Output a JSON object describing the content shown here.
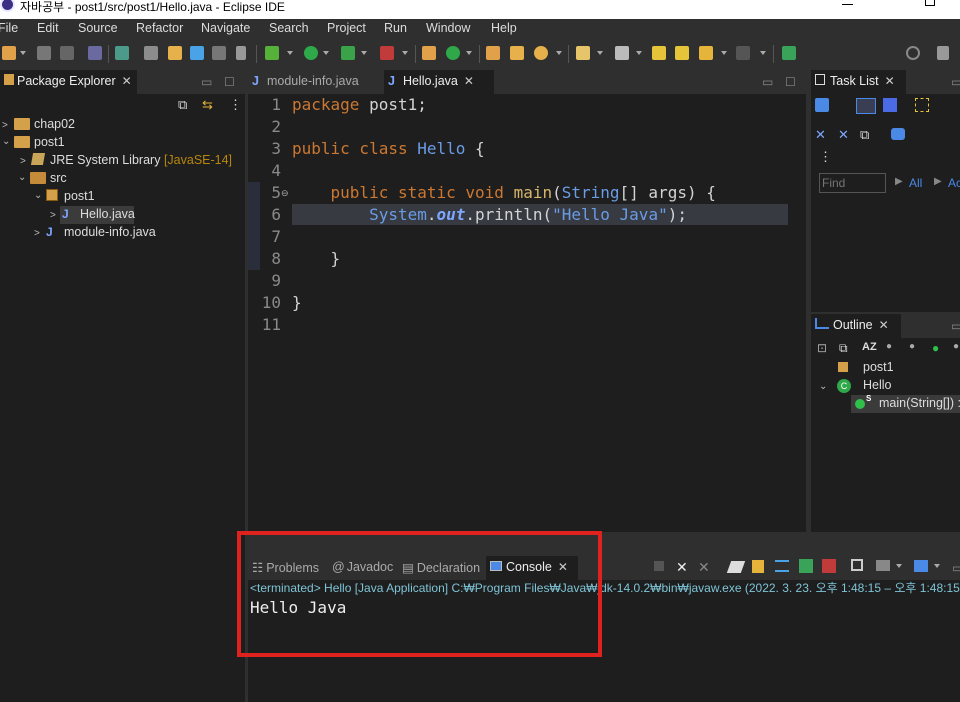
{
  "window": {
    "title": "자바공부 - post1/src/post1/Hello.java - Eclipse IDE"
  },
  "menu": [
    "File",
    "Edit",
    "Source",
    "Refactor",
    "Navigate",
    "Search",
    "Project",
    "Run",
    "Window",
    "Help"
  ],
  "package_explorer": {
    "tab_label": "Package Explorer",
    "items": [
      {
        "label": "chap02",
        "indent": 0,
        "expanded": false
      },
      {
        "label": "post1",
        "indent": 0,
        "expanded": true
      },
      {
        "label": "JRE System Library",
        "suffix": "[JavaSE-14]",
        "indent": 1,
        "expanded": false
      },
      {
        "label": "src",
        "indent": 1,
        "expanded": true
      },
      {
        "label": "post1",
        "indent": 2,
        "expanded": true
      },
      {
        "label": "Hello.java",
        "indent": 3,
        "expanded": false,
        "selected": true
      },
      {
        "label": "module-info.java",
        "indent": 2,
        "expanded": false
      }
    ]
  },
  "editor": {
    "tabs": [
      {
        "label": "module-info.java",
        "active": false
      },
      {
        "label": "Hello.java",
        "active": true
      }
    ],
    "line_numbers": [
      "1",
      "2",
      "3",
      "4",
      "5",
      "6",
      "7",
      "8",
      "9",
      "10",
      "11"
    ],
    "lines": {
      "l1_kw": "package",
      "l1_rest": " post1;",
      "l3_kw": "public class",
      "l3_type": "Hello",
      "l3_rest": " {",
      "l5_kw": "public static void",
      "l5_fn": "main",
      "l5_p1": "(",
      "l5_type": "String",
      "l5_p2": "[] args) {",
      "l6_type": "System",
      "l6_dot": ".",
      "l6_field": "out",
      "l6_call": ".println(",
      "l6_str": "\"Hello Java\"",
      "l6_end": ");",
      "l8": "}",
      "l10": "}"
    }
  },
  "task_list": {
    "tab_label": "Task List",
    "find_placeholder": "Find",
    "all_label": "All",
    "activate_label": "Ac"
  },
  "outline": {
    "tab_label": "Outline",
    "items": [
      {
        "label": "post1"
      },
      {
        "label": "Hello"
      },
      {
        "label": "main(String[]) :"
      }
    ]
  },
  "console": {
    "tabs": [
      {
        "label": "Problems",
        "active": false
      },
      {
        "label": "Javadoc",
        "active": false
      },
      {
        "label": "Declaration",
        "active": false
      },
      {
        "label": "Console",
        "active": true
      }
    ],
    "status": "<terminated> Hello [Java Application] C:₩Program Files₩Java₩jdk-14.0.2₩bin₩javaw.exe  (2022. 3. 23. 오후 1:48:15 – 오후 1:48:15",
    "output": "Hello Java"
  },
  "colors": {
    "highlight": "#e0221f",
    "keyword": "#cc7832",
    "type": "#6a9ce6",
    "method": "#d9b66b"
  }
}
